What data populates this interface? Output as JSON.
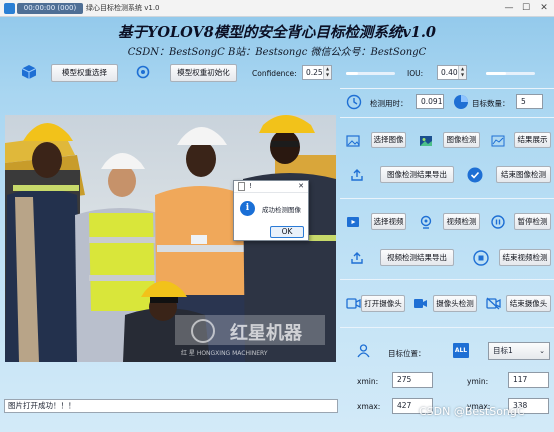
{
  "window": {
    "title_redacted": "00:00:00 (000)",
    "title_suffix": "绿心目标检测系统 v1.0",
    "controls": {
      "minimize": "—",
      "maximize": "☐",
      "close": "✕"
    }
  },
  "header": {
    "title": "基于YOLOV8模型的安全背心目标检测系统v1.0",
    "subtitle": "CSDN：BestSongC   B站：Bestsongc   微信公众号：BestSongC"
  },
  "toolbar": {
    "model_select_label": "模型权重选择",
    "model_init_label": "模型权重初始化",
    "confidence_label": "Confidence:",
    "confidence_value": "0.25",
    "confidence_level": 0.25,
    "iou_label": "IOU:",
    "iou_value": "0.40",
    "iou_level": 0.4
  },
  "stats": {
    "time_label": "检测用时：",
    "time_value": "0.091",
    "count_label": "目标数量：",
    "count_value": "5"
  },
  "image_section": {
    "select_label": "选择图像",
    "detect_label": "图像检测",
    "result_label": "结果展示",
    "export_label": "图像检测结果导出",
    "end_label": "结束图像检测"
  },
  "video_section": {
    "select_label": "选择视频",
    "detect_label": "视频检测",
    "pause_label": "暂停检测",
    "export_label": "视频检测结果导出",
    "end_label": "结束视频检测"
  },
  "camera_section": {
    "open_label": "打开摄像头",
    "detect_label": "摄像头检测",
    "end_label": "结束摄像头"
  },
  "target": {
    "position_label": "目标位置：",
    "all_label": "ALL",
    "selected_option": "目标1",
    "xmin_label": "xmin:",
    "xmin_value": "275",
    "ymin_label": "ymin:",
    "ymin_value": "117",
    "xmax_label": "xmax:",
    "xmax_value": "427",
    "ymax_label": "ymax:",
    "ymax_value": "338"
  },
  "photo": {
    "logo_text": "红星机器",
    "logo_subtext": "红  星  HONGXING MACHINERY"
  },
  "dialog": {
    "title": "!",
    "message": "成功检测图像",
    "ok_label": "OK",
    "close": "✕",
    "info_glyph": "i"
  },
  "status": {
    "message": "图片打开成功！！！"
  },
  "watermark": "CSDN @BestSongC",
  "colors": {
    "accent_blue": "#1a6fd6",
    "background_top": "#8fc7ea",
    "background_bottom": "#d3eaf8"
  }
}
